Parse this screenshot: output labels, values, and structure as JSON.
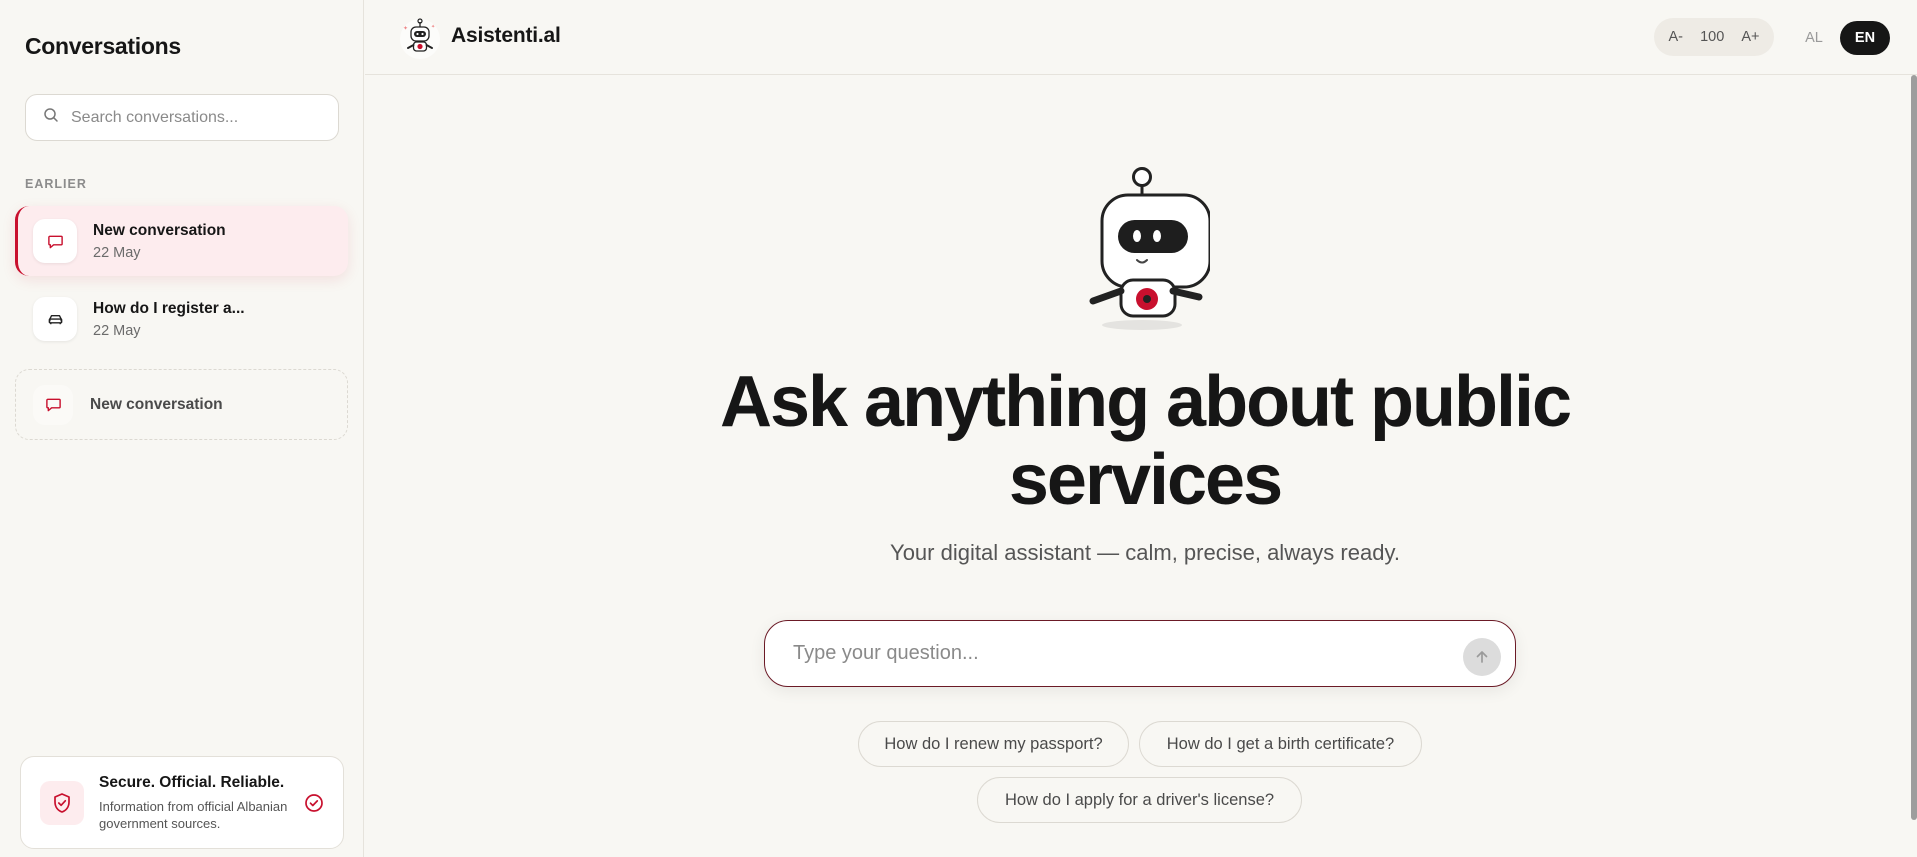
{
  "sidebar": {
    "title": "Conversations",
    "search_placeholder": "Search conversations...",
    "section_label": "EARLIER",
    "items": [
      {
        "title": "New conversation",
        "date": "22 May",
        "icon": "chat-bubble-icon"
      },
      {
        "title": "How do I register a...",
        "date": "22 May",
        "icon": "car-icon"
      }
    ],
    "new_conversation_label": "New conversation",
    "trust": {
      "title": "Secure. Official. Reliable.",
      "description": "Information from official Albanian government sources."
    }
  },
  "header": {
    "brand": "Asistenti.al",
    "font_decrease": "A-",
    "font_size": "100",
    "font_increase": "A+",
    "lang_al": "AL",
    "lang_en": "EN",
    "active_lang": "EN"
  },
  "main": {
    "title": "Ask anything about public services",
    "subtitle": "Your digital assistant — calm, precise, always ready.",
    "input_placeholder": "Type your question...",
    "suggestions": [
      "How do I renew my passport?",
      "How do I get a birth certificate?",
      "How do I apply for a driver's license?"
    ]
  },
  "colors": {
    "accent": "#c8102e",
    "background": "#f8f7f3",
    "active_item_bg": "#fdecee",
    "dark": "#161616"
  }
}
